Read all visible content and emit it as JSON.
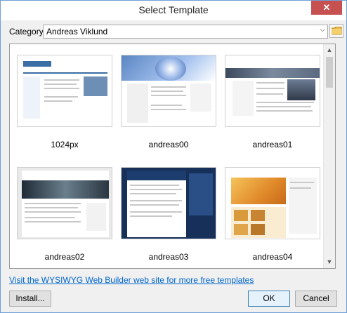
{
  "window": {
    "title": "Select Template",
    "close_glyph": "✕"
  },
  "category": {
    "label": "Category:",
    "value": "Andreas Viklund"
  },
  "templates": [
    {
      "name": "1024px"
    },
    {
      "name": "andreas00"
    },
    {
      "name": "andreas01"
    },
    {
      "name": "andreas02"
    },
    {
      "name": "andreas03"
    },
    {
      "name": "andreas04"
    }
  ],
  "footer": {
    "link_text": "Visit the WYSIWYG Web Builder web site for more free templates"
  },
  "buttons": {
    "install": "Install...",
    "ok": "OK",
    "cancel": "Cancel"
  },
  "icons": {
    "folder": "folder-icon",
    "scroll_up": "chevron-up-icon",
    "scroll_down": "chevron-down-icon"
  },
  "colors": {
    "accent": "#0066cc",
    "close": "#c75050"
  }
}
